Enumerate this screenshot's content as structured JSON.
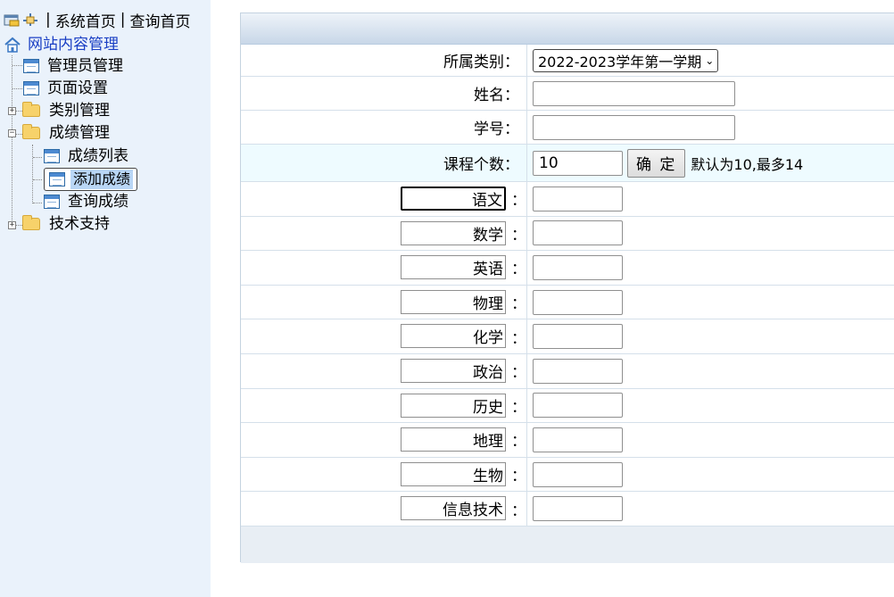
{
  "topbar": {
    "home_link": "系统首页",
    "separator": "|",
    "query_link": "查询首页"
  },
  "tree": {
    "root": "网站内容管理",
    "items": [
      {
        "label": "管理员管理"
      },
      {
        "label": "页面设置"
      },
      {
        "label": "类别管理",
        "expander": "+"
      },
      {
        "label": "成绩管理",
        "expander": "−"
      },
      {
        "label": "成绩列表"
      },
      {
        "label": "添加成绩",
        "selected": true
      },
      {
        "label": "查询成绩"
      },
      {
        "label": "技术支持",
        "expander": "+"
      }
    ]
  },
  "form": {
    "category_label": "所属类别：",
    "category_value": "2022-2023学年第一学期",
    "name_label": "姓名：",
    "name_value": "",
    "student_id_label": "学号：",
    "student_id_value": "",
    "course_count_label": "课程个数：",
    "course_count_value": "10",
    "confirm_label": "确 定",
    "hint": "默认为10,最多14",
    "colon": "：",
    "courses": [
      {
        "name": "语文",
        "score": ""
      },
      {
        "name": "数学",
        "score": ""
      },
      {
        "name": "英语",
        "score": ""
      },
      {
        "name": "物理",
        "score": ""
      },
      {
        "name": "化学",
        "score": ""
      },
      {
        "name": "政治",
        "score": ""
      },
      {
        "name": "历史",
        "score": ""
      },
      {
        "name": "地理",
        "score": ""
      },
      {
        "name": "生物",
        "score": ""
      },
      {
        "name": "信息技术",
        "score": ""
      }
    ]
  },
  "colors": {
    "sidebar_bg": "#eaf2fb",
    "root_link": "#1a3fc4",
    "selected_bg": "#b9d6f5",
    "highlight_row": "#eefbff"
  }
}
